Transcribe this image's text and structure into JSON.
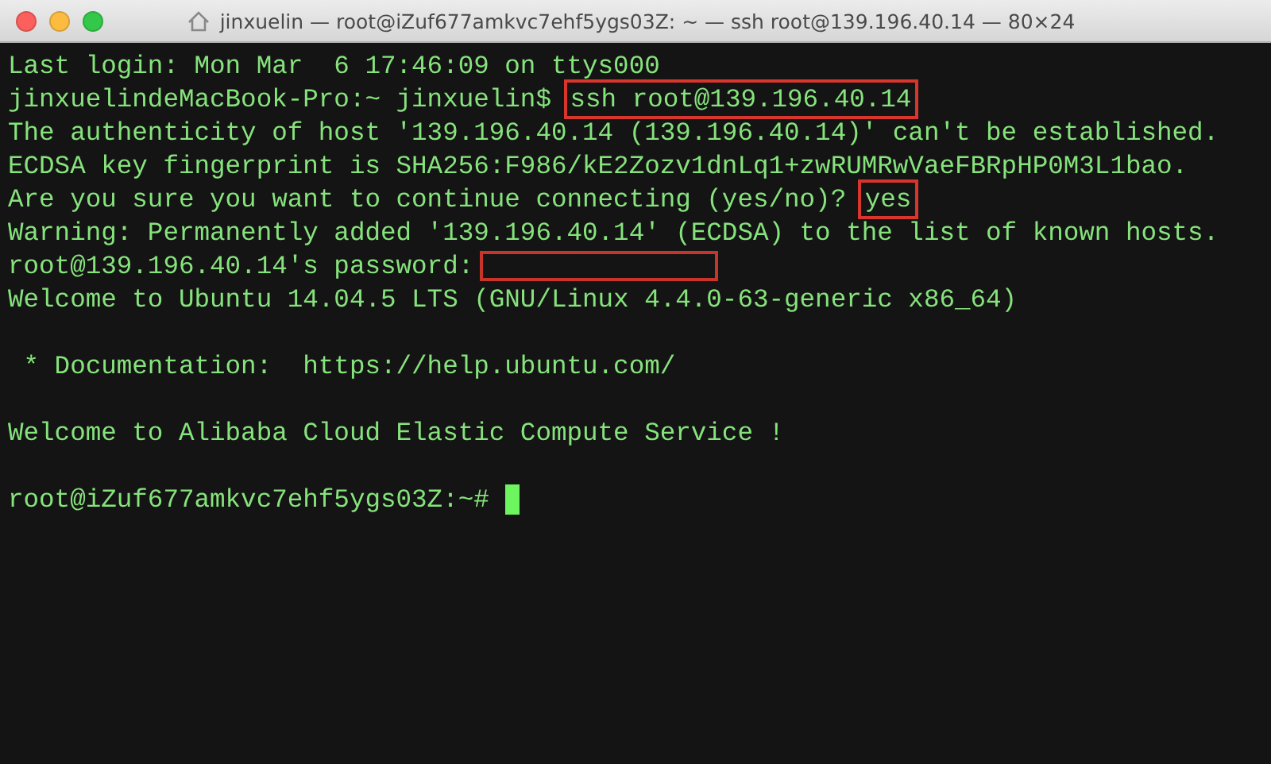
{
  "window": {
    "title": "jinxuelin — root@iZuf677amkvc7ehf5ygs03Z: ~ — ssh root@139.196.40.14 — 80×24"
  },
  "terminal": {
    "lines": [
      {
        "kind": "output",
        "segments": [
          {
            "text": "Last login: Mon Mar  6 17:46:09 on ttys000",
            "highlighted": false
          }
        ]
      },
      {
        "kind": "output",
        "segments": [
          {
            "text": "jinxuelindeMacBook-Pro:~ jinxuelin$ ",
            "highlighted": false
          },
          {
            "text": "ssh root@139.196.40.14",
            "highlighted": true
          }
        ]
      },
      {
        "kind": "output",
        "segments": [
          {
            "text": "The authenticity of host '139.196.40.14 (139.196.40.14)' can't be established.",
            "highlighted": false
          }
        ]
      },
      {
        "kind": "output",
        "segments": [
          {
            "text": "ECDSA key fingerprint is SHA256:F986/kE2Zozv1dnLq1+zwRUMRwVaeFBRpHP0M3L1bao.",
            "highlighted": false
          }
        ]
      },
      {
        "kind": "output",
        "segments": [
          {
            "text": "Are you sure you want to continue connecting (yes/no)? ",
            "highlighted": false
          },
          {
            "text": "yes",
            "highlighted": true
          }
        ]
      },
      {
        "kind": "output",
        "segments": [
          {
            "text": "Warning: Permanently added '139.196.40.14' (ECDSA) to the list of known hosts.",
            "highlighted": false
          }
        ]
      },
      {
        "kind": "password",
        "segments": [
          {
            "text": "root@139.196.40.14's password:",
            "highlighted": false
          }
        ]
      },
      {
        "kind": "output",
        "segments": [
          {
            "text": "Welcome to Ubuntu 14.04.5 LTS (GNU/Linux 4.4.0-63-generic x86_64)",
            "highlighted": false
          }
        ]
      },
      {
        "kind": "blank"
      },
      {
        "kind": "output",
        "segments": [
          {
            "text": " * Documentation:  https://help.ubuntu.com/",
            "highlighted": false
          }
        ]
      },
      {
        "kind": "blank"
      },
      {
        "kind": "output",
        "segments": [
          {
            "text": "Welcome to Alibaba Cloud Elastic Compute Service !",
            "highlighted": false
          }
        ]
      },
      {
        "kind": "blank"
      },
      {
        "kind": "prompt",
        "cursor": true,
        "segments": [
          {
            "text": "root@iZuf677amkvc7ehf5ygs03Z:~# ",
            "highlighted": false
          }
        ]
      }
    ]
  }
}
